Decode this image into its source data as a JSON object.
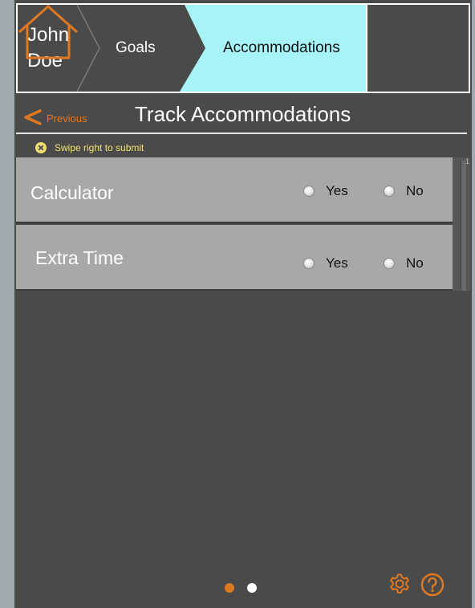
{
  "breadcrumb": {
    "name_first": "John",
    "name_last": "Doe",
    "goals_label": "Goals",
    "accommodations_label": "Accommodations"
  },
  "nav": {
    "previous_label": "Previous",
    "title": "Track Accommodations"
  },
  "hint": {
    "text": "Swipe right to submit"
  },
  "accommodations": [
    {
      "label": "Calculator",
      "yes_label": "Yes",
      "no_label": "No"
    },
    {
      "label": "Extra Time",
      "yes_label": "Yes",
      "no_label": "No"
    }
  ],
  "scroll_marker": "1",
  "pager": {
    "total": 2,
    "active": 1
  },
  "colors": {
    "background": "#4a4a4a",
    "active_crumb": "#a6f4f8",
    "accent": "#e07820",
    "row": "#a8a8a8",
    "hint_text": "#f0e070"
  },
  "icons": {
    "home": "home-icon",
    "previous": "chevron-left-icon",
    "hint": "close-circle-icon",
    "settings": "gear-icon",
    "help": "help-icon"
  }
}
